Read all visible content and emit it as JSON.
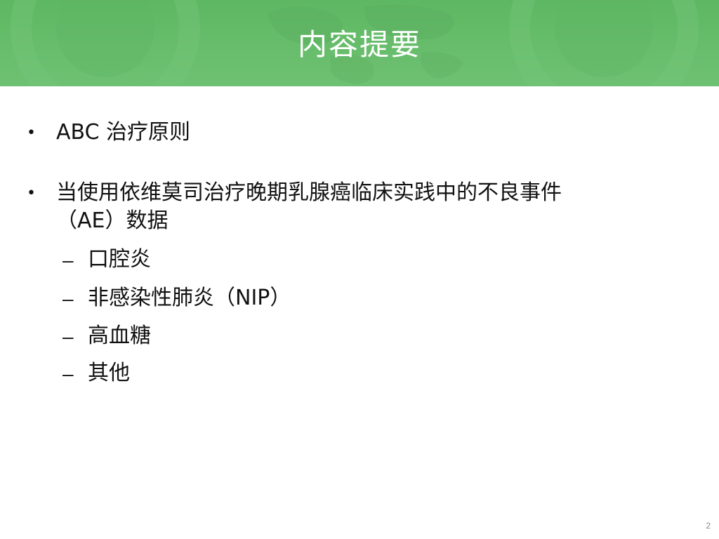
{
  "slide": {
    "title": "内容提要",
    "bullet_glyph": "•",
    "dash_glyph": "–",
    "items": [
      {
        "text": "ABC 治疗原则"
      },
      {
        "text_line1": "当使用依维莫司治疗晚期乳腺癌临床实践中的不良事件",
        "text_line2": "（AE）数据"
      }
    ],
    "sub_items": [
      {
        "text": "口腔炎"
      },
      {
        "text": "非感染性肺炎（NIP）"
      },
      {
        "text": "高血糖"
      },
      {
        "text": "其他"
      }
    ],
    "page_number": "2"
  },
  "colors": {
    "header_green": "#67bd6b",
    "title_text": "#ffffff",
    "body_text": "#111111"
  }
}
